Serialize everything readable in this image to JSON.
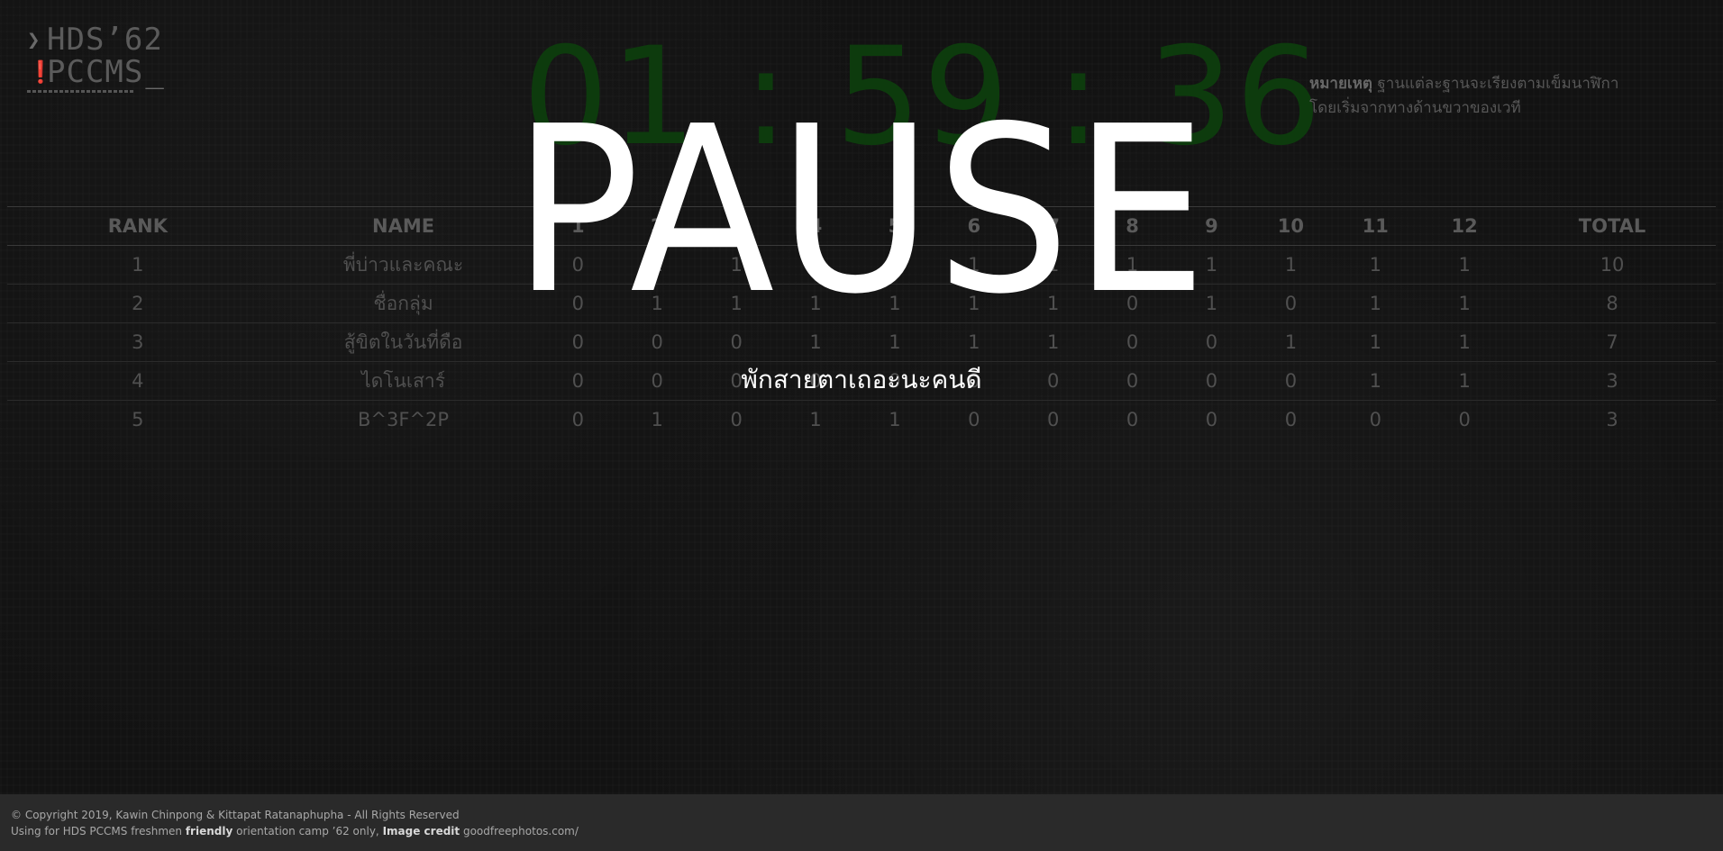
{
  "logo": {
    "line1": "HDS’62",
    "line2": "PCCMS",
    "cursor": "_"
  },
  "timer": {
    "value": "01 : 59 : 36",
    "color": "#0d3b0d"
  },
  "note": {
    "label": "หมายเหตุ",
    "line1": " ฐานแต่ละฐานจะเรียงตามเข็มนาฬิกา",
    "line2": "โดยเริ่มจากทางด้านขวาของเวที"
  },
  "scoreboard": {
    "headers": [
      "RANK",
      "NAME",
      "1",
      "2",
      "3",
      "4",
      "5",
      "6",
      "7",
      "8",
      "9",
      "10",
      "11",
      "12",
      "TOTAL"
    ],
    "rows": [
      [
        "1",
        "พี่บ่าวและคณะ",
        "0",
        "1",
        "1",
        "1",
        "1",
        "1",
        "1",
        "1",
        "1",
        "1",
        "1",
        "1",
        "10"
      ],
      [
        "2",
        "ชื่อกลุ่ม",
        "0",
        "1",
        "1",
        "1",
        "1",
        "1",
        "1",
        "0",
        "1",
        "0",
        "1",
        "1",
        "8"
      ],
      [
        "3",
        "สู้ขิตในวันที่ดือ",
        "0",
        "0",
        "0",
        "1",
        "1",
        "1",
        "1",
        "0",
        "0",
        "1",
        "1",
        "1",
        "7"
      ],
      [
        "4",
        "ไดโนเสาร์",
        "0",
        "0",
        "0",
        "0",
        "0",
        "0",
        "0",
        "0",
        "0",
        "0",
        "1",
        "1",
        "3"
      ],
      [
        "5",
        "B^3F^2P",
        "0",
        "1",
        "0",
        "1",
        "1",
        "0",
        "0",
        "0",
        "0",
        "0",
        "0",
        "0",
        "3"
      ]
    ]
  },
  "overlay": {
    "title": "PAUSE",
    "subtitle": "พักสายตาเถอะนะคนดี"
  },
  "footer": {
    "copyright": "© Copyright 2019, Kawin Chinpong & Kittapat Ratanaphupha - All Rights Reserved",
    "line2_pre": "Using for HDS PCCMS freshmen ",
    "line2_bold1": "friendly",
    "line2_mid": " orientation camp ’62 only, ",
    "line2_bold2": "Image credit",
    "line2_post": " goodfreephotos.com/"
  }
}
